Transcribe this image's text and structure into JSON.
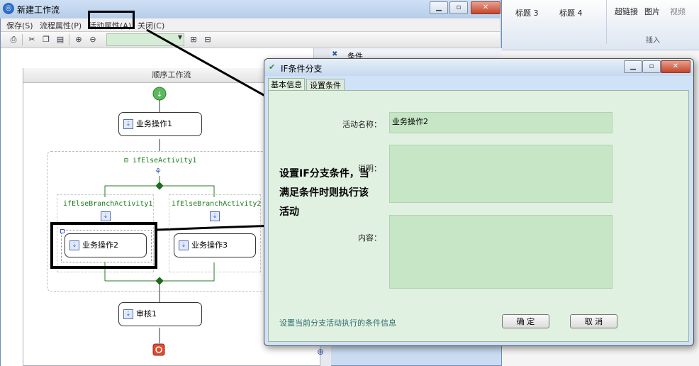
{
  "ribbon": {
    "heading3": "标题 3",
    "heading4": "标题 4",
    "hyperlink": "超链接",
    "picture": "图片",
    "video": "视频",
    "group_insert": "插入"
  },
  "main_window": {
    "title": "新建工作流",
    "menu": [
      "保存(S)",
      "流程属性(P)",
      "活动属性(A)",
      "关闭(C)"
    ],
    "properties_panel_title": "条件",
    "sequence_title": "顺序工作流",
    "activities": {
      "op1": "业务操作1",
      "ifelse": "ifElseActivity1",
      "branch1": "ifElseBranchActivity1",
      "branch2": "ifElseBranchActivity2",
      "op2": "业务操作2",
      "op3": "业务操作3",
      "review": "审核1"
    }
  },
  "dialog": {
    "title": "IF条件分支",
    "tabs": [
      "基本信息",
      "设置条件"
    ],
    "activity_name_label": "活动名称：",
    "activity_name_value": "业务操作2",
    "description_label": "说明：",
    "content_label": "内容：",
    "status_text": "设置当前分支活动执行的条件信息",
    "ok_label": "确 定",
    "cancel_label": "取 消"
  },
  "callout_text": "设置IF分支条件，当满足条件时则执行该活动"
}
